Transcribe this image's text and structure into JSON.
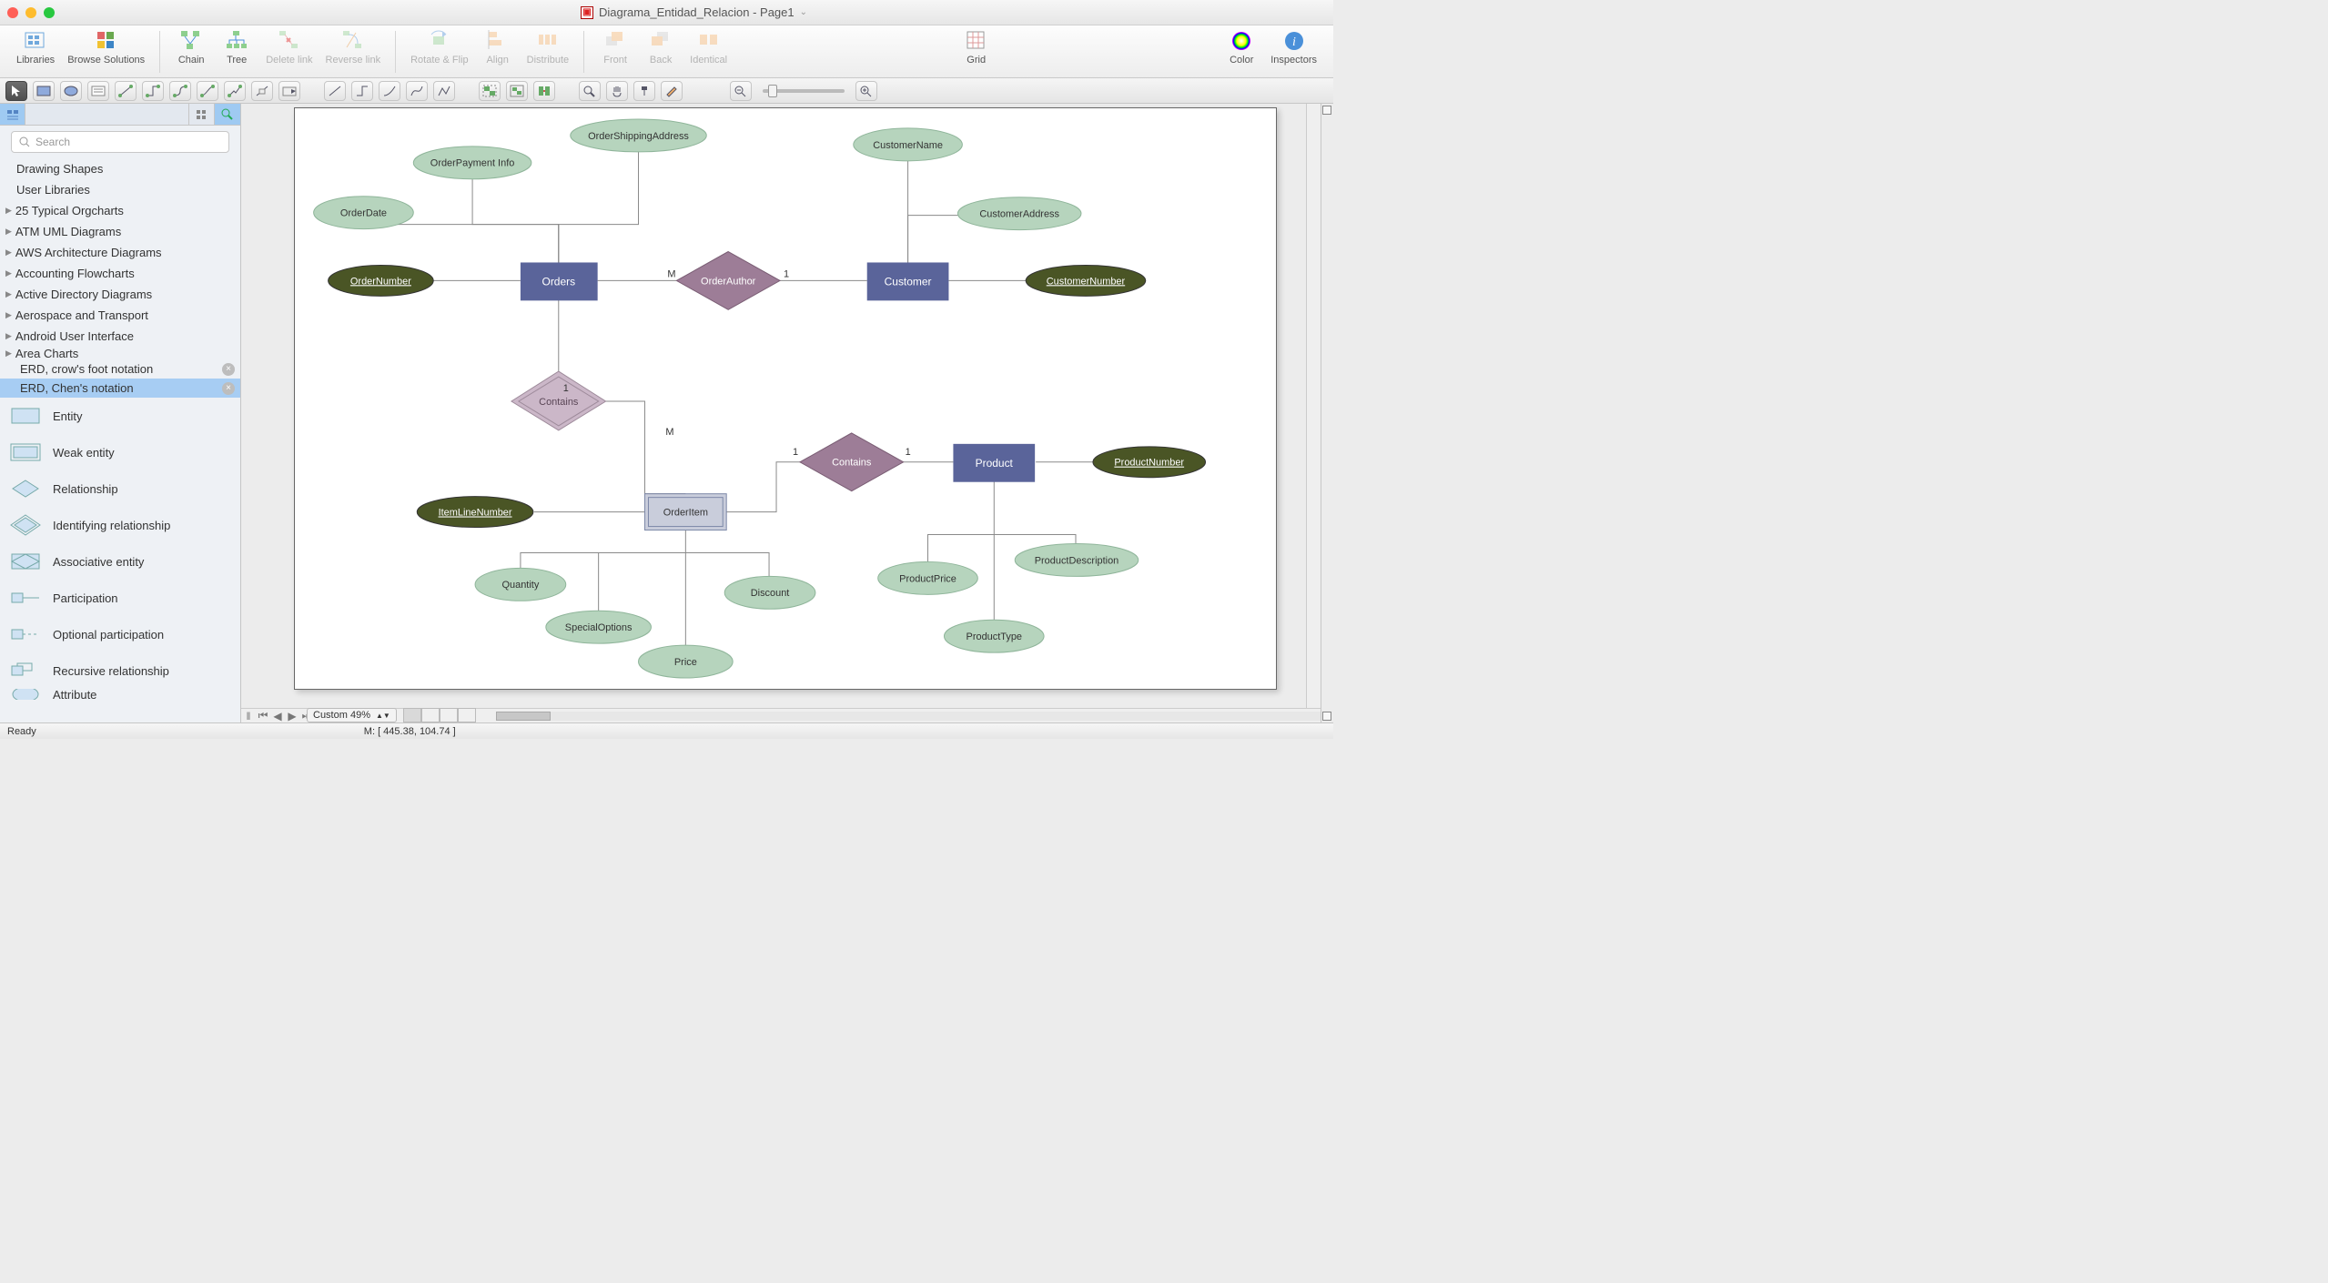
{
  "window": {
    "title": "Diagrama_Entidad_Relacion - Page1"
  },
  "main_toolbar": {
    "libraries": "Libraries",
    "browse": "Browse Solutions",
    "chain": "Chain",
    "tree": "Tree",
    "delete_link": "Delete link",
    "reverse_link": "Reverse link",
    "rotate_flip": "Rotate & Flip",
    "align": "Align",
    "distribute": "Distribute",
    "front": "Front",
    "back": "Back",
    "identical": "Identical",
    "grid": "Grid",
    "color": "Color",
    "inspectors": "Inspectors"
  },
  "search": {
    "placeholder": "Search"
  },
  "library_categories": {
    "drawing_shapes": "Drawing Shapes",
    "user_libraries": "User Libraries",
    "typical_orgcharts": "25 Typical Orgcharts",
    "atm_uml": "ATM UML Diagrams",
    "aws": "AWS Architecture Diagrams",
    "accounting": "Accounting Flowcharts",
    "active_directory": "Active Directory Diagrams",
    "aerospace": "Aerospace and Transport",
    "android": "Android User Interface",
    "area_charts": "Area Charts"
  },
  "open_libraries": {
    "crowfoot": "ERD, crow's foot notation",
    "chen": "ERD, Chen's notation"
  },
  "shapes": {
    "entity": "Entity",
    "weak_entity": "Weak entity",
    "relationship": "Relationship",
    "identifying_relationship": "Identifying relationship",
    "associative_entity": "Associative entity",
    "participation": "Participation",
    "optional_participation": "Optional participation",
    "recursive_relationship": "Recursive relationship",
    "attribute": "Attribute"
  },
  "diagram": {
    "entities": {
      "orders": "Orders",
      "customer": "Customer",
      "product": "Product",
      "orderitem": "OrderItem"
    },
    "relationships": {
      "orderauthor": "OrderAuthor",
      "contains1": "Contains",
      "contains2": "Contains"
    },
    "attributes": {
      "orderdate": "OrderDate",
      "orderpayment": "OrderPayment Info",
      "ordershipping": "OrderShippingAddress",
      "customername": "CustomerName",
      "customeraddress": "CustomerAddress",
      "quantity": "Quantity",
      "specialoptions": "SpecialOptions",
      "price": "Price",
      "discount": "Discount",
      "productprice": "ProductPrice",
      "producttype": "ProductType",
      "productdesc": "ProductDescription"
    },
    "keys": {
      "ordernumber": "OrderNumber",
      "customernumber": "CustomerNumber",
      "itemlinenumber": "ItemLineNumber",
      "productnumber": "ProductNumber"
    },
    "cardinalities": {
      "m1": "M",
      "one1": "1",
      "one2": "1",
      "m2": "M",
      "one3": "1",
      "one4": "1"
    }
  },
  "footer": {
    "zoom": "Custom 49%",
    "status": "Ready",
    "coords": "M: [ 445.38, 104.74 ]"
  }
}
